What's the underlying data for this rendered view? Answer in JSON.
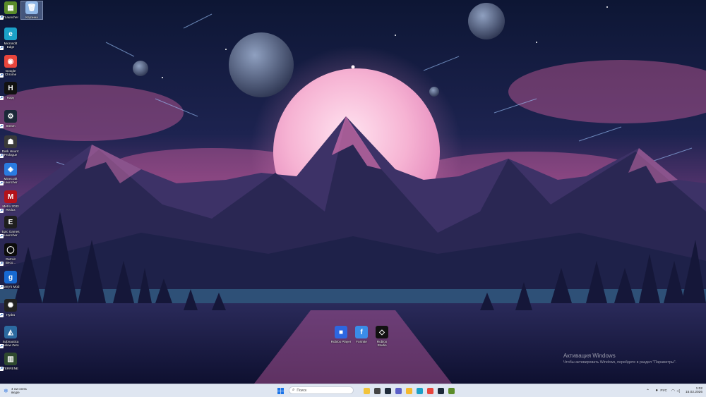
{
  "desktop": {
    "icons": [
      {
        "label": "TLauncher",
        "icon": "tlauncher-icon",
        "color": "#5b8c2a",
        "glyph": "▦"
      },
      {
        "label": "Корзина",
        "icon": "recycle-bin-icon",
        "color": "#8fb6e6",
        "glyph": "🗑"
      },
      {
        "label": "Microsoft\nEdge",
        "icon": "edge-icon",
        "color": "#1ba0c7",
        "glyph": "e"
      },
      {
        "label": "Google\nChrome",
        "icon": "chrome-icon",
        "color": "#e8453c",
        "glyph": "◉"
      },
      {
        "label": "Нару",
        "icon": "hapy-icon",
        "color": "#111111",
        "glyph": "H"
      },
      {
        "label": "Steam",
        "icon": "steam-icon",
        "color": "#1b2838",
        "glyph": "⚙"
      },
      {
        "label": "Dark Hours:\nPrologue",
        "icon": "dark-hours-icon",
        "color": "#3a3a3a",
        "glyph": "☗"
      },
      {
        "label": "Minecraft\nLauncher",
        "icon": "minecraft-icon",
        "color": "#2a7be0",
        "glyph": "◈"
      },
      {
        "label": "Metro 2033\nRedux",
        "icon": "metro-icon",
        "color": "#b3121b",
        "glyph": "M"
      },
      {
        "label": "Epic Games\nLauncher",
        "icon": "epic-games-icon",
        "color": "#1e1e1e",
        "glyph": "E"
      },
      {
        "label": "Detroit\nBeco...",
        "icon": "detroit-icon",
        "color": "#0c0c0c",
        "glyph": "◯"
      },
      {
        "label": "Garry's Mod",
        "icon": "garrys-mod-icon",
        "color": "#1769d1",
        "glyph": "g"
      },
      {
        "label": "Hydra",
        "icon": "hydra-icon",
        "color": "#222222",
        "glyph": "✺"
      },
      {
        "label": "Subnautica\nBelow Zero",
        "icon": "subnautica-icon",
        "color": "#2c6aa0",
        "glyph": "◭"
      },
      {
        "label": "TERRENE",
        "icon": "terrene-icon",
        "color": "#2f4a2f",
        "glyph": "▥"
      }
    ],
    "center_icons": [
      {
        "label": "Roblox Player",
        "icon": "roblox-player-icon",
        "color": "#2d67e0",
        "glyph": "■"
      },
      {
        "label": "Fortnite",
        "icon": "fortnite-icon",
        "color": "#3a8ce8",
        "glyph": "f"
      },
      {
        "label": "Roblox\nStudio",
        "icon": "roblox-studio-icon",
        "color": "#111111",
        "glyph": "◇"
      }
    ]
  },
  "activation": {
    "title": "Активация Windows",
    "subtitle": "Чтобы активировать Windows, перейдите в раздел \"Параметры\"."
  },
  "taskbar": {
    "weather_temp": "4 см снега",
    "weather_desc": "вкуре",
    "search_placeholder": "Поиск",
    "apps": [
      {
        "name": "explorer",
        "icon": "file-explorer-icon",
        "color": "#f2c33b"
      },
      {
        "name": "task-view",
        "icon": "task-view-icon",
        "color": "#444444"
      },
      {
        "name": "photos",
        "icon": "photos-icon",
        "color": "#1f2b3a"
      },
      {
        "name": "teams",
        "icon": "teams-icon",
        "color": "#5b5fc7"
      },
      {
        "name": "folder",
        "icon": "folder-icon",
        "color": "#f5b82e"
      },
      {
        "name": "edge",
        "icon": "edge-taskbar-icon",
        "color": "#1ba0c7"
      },
      {
        "name": "chrome",
        "icon": "chrome-taskbar-icon",
        "color": "#e8453c"
      },
      {
        "name": "steam",
        "icon": "steam-taskbar-icon",
        "color": "#1b2838"
      },
      {
        "name": "minecraft",
        "icon": "minecraft-taskbar-icon",
        "color": "#5b8c2a"
      }
    ],
    "language": "РУС",
    "time": "1:02",
    "date": "15.02.2026"
  }
}
